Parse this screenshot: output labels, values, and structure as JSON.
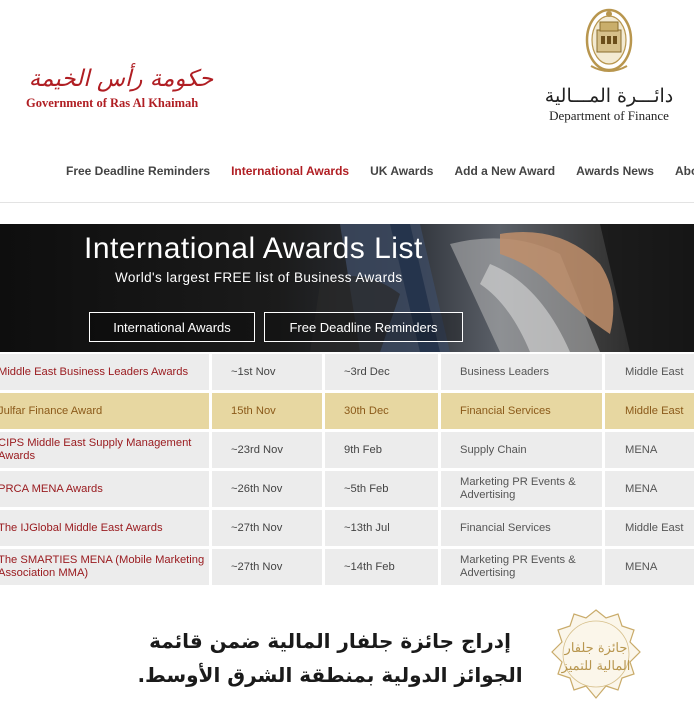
{
  "header": {
    "rak_logo_arabic": "حكومة رأس الخيمة",
    "rak_logo_english": "Government of Ras Al Khaimah",
    "dof_logo_arabic": "دائـــرة المـــالية",
    "dof_logo_english": "Department of Finance"
  },
  "nav": {
    "items": [
      {
        "label": "Free Deadline Reminders",
        "active": false
      },
      {
        "label": "International Awards",
        "active": true
      },
      {
        "label": "UK Awards",
        "active": false
      },
      {
        "label": "Add a New Award",
        "active": false
      },
      {
        "label": "Awards News",
        "active": false
      },
      {
        "label": "About",
        "active": false
      }
    ]
  },
  "banner": {
    "title": "International Awards List",
    "subtitle": "World's largest FREE list of Business Awards",
    "button_1": "International Awards",
    "button_2": "Free Deadline Reminders"
  },
  "table": {
    "rows": [
      {
        "name": "Middle East Business Leaders Awards",
        "open": "~1st Nov",
        "deadline": "~3rd Dec",
        "category": "Business Leaders",
        "region": "Middle East",
        "highlight": false
      },
      {
        "name": "Julfar Finance Award",
        "open": "15th Nov",
        "deadline": "30th Dec",
        "category": "Financial Services",
        "region": "Middle East",
        "highlight": true
      },
      {
        "name": "CIPS Middle East Supply Management Awards",
        "open": "~23rd Nov",
        "deadline": "9th Feb",
        "category": "Supply Chain",
        "region": "MENA",
        "highlight": false
      },
      {
        "name": "PRCA MENA Awards",
        "open": "~26th Nov",
        "deadline": "~5th Feb",
        "category": "Marketing PR Events & Advertising",
        "region": "MENA",
        "highlight": false
      },
      {
        "name": "The IJGlobal Middle East Awards",
        "open": "~27th Nov",
        "deadline": "~13th Jul",
        "category": "Financial Services",
        "region": "Middle East",
        "highlight": false
      },
      {
        "name": "The SMARTIES MENA (Mobile Marketing Association MMA)",
        "open": "~27th Nov",
        "deadline": "~14th Feb",
        "category": "Marketing PR Events & Advertising",
        "region": "MENA",
        "highlight": false
      }
    ]
  },
  "overlay": {
    "caption": "إدراج جائزة جلفار المالية ضمن قائمة الجوائز الدولية بمنطقة الشرق الأوسط.",
    "seal_text": "جائزة جلفار المالية للتميز"
  },
  "colors": {
    "brand_red": "#b01e23",
    "row_bg": "#ececec",
    "highlight_bg": "#e7d7a1",
    "seal_gold": "#b8964e"
  }
}
